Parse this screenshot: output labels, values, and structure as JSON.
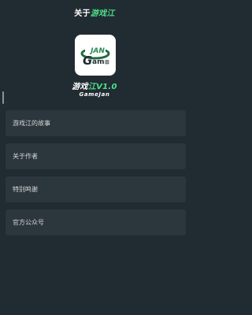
{
  "header": {
    "title_prefix": "关于",
    "title_accent": "游戏江"
  },
  "app": {
    "logo_icon": "gamejan-logo-icon",
    "logo_text_top": "JAN",
    "logo_text_bottom": "am",
    "name_prefix": "游戏",
    "name_accent": "江",
    "version": "V1.0",
    "subtitle": "GameJan"
  },
  "menu": {
    "items": [
      {
        "label": "游戏江的故事"
      },
      {
        "label": "关于作者"
      },
      {
        "label": "特别鸣谢"
      },
      {
        "label": "官方公众号"
      }
    ]
  },
  "colors": {
    "background": "#212b32",
    "card": "#2c363d",
    "accent": "#4ee08a",
    "text": "#d9d9d9"
  }
}
